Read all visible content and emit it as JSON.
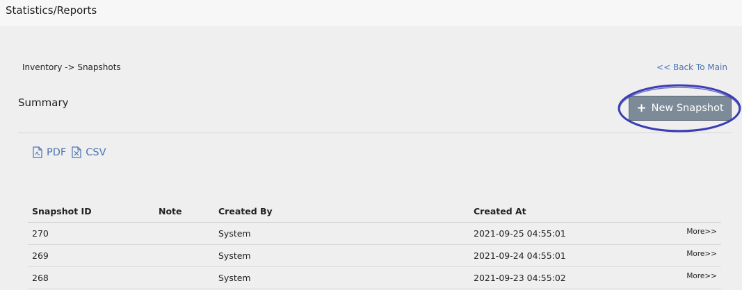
{
  "topbar": {
    "title": "Statistics/Reports"
  },
  "breadcrumb": "Inventory -> Snapshots",
  "back_link": "<< Back To Main",
  "summary": {
    "title": "Summary"
  },
  "new_snapshot": {
    "label": "New Snapshot",
    "icon": "plus-icon"
  },
  "annotation": {
    "color": "#3b3fb3",
    "shape": "oval around New Snapshot button"
  },
  "export": {
    "pdf_label": "PDF",
    "pdf_icon": "pdf-file-icon",
    "csv_label": "CSV",
    "csv_icon": "excel-file-icon"
  },
  "table": {
    "headers": [
      "Snapshot ID",
      "Note",
      "Created By",
      "Created At",
      ""
    ],
    "rows": [
      {
        "id": "270",
        "note": "",
        "created_by": "System",
        "created_at": "2021-09-25 04:55:01",
        "more": "More>>"
      },
      {
        "id": "269",
        "note": "",
        "created_by": "System",
        "created_at": "2021-09-24 04:55:01",
        "more": "More>>"
      },
      {
        "id": "268",
        "note": "",
        "created_by": "System",
        "created_at": "2021-09-23 04:55:02",
        "more": "More>>"
      }
    ]
  },
  "colors": {
    "link": "#4a73b5",
    "button_bg": "#7d8b98",
    "annotation": "#3b3fb3"
  }
}
